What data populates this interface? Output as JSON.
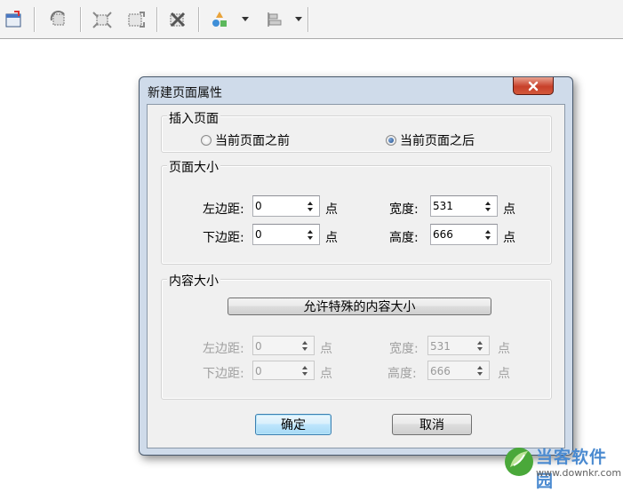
{
  "toolbar": {
    "icons": [
      "page-icon",
      "rotate-icon",
      "fit-page-icon",
      "fit-content-icon",
      "delete-icon",
      "shapes-icon",
      "align-icon"
    ]
  },
  "dialog": {
    "title": "新建页面属性",
    "insert_group": {
      "label": "插入页面",
      "option_before": "当前页面之前",
      "option_after": "当前页面之后",
      "selected": "option_after"
    },
    "page_size_group": {
      "label": "页面大小",
      "left_margin_label": "左边距:",
      "left_margin_value": "0",
      "bottom_margin_label": "下边距:",
      "bottom_margin_value": "0",
      "width_label": "宽度:",
      "width_value": "531",
      "height_label": "高度:",
      "height_value": "666",
      "unit": "点"
    },
    "content_size_group": {
      "label": "内容大小",
      "allow_button": "允许特殊的内容大小",
      "left_margin_label": "左边距:",
      "left_margin_value": "0",
      "bottom_margin_label": "下边距:",
      "bottom_margin_value": "0",
      "width_label": "宽度:",
      "width_value": "531",
      "height_label": "高度:",
      "height_value": "666",
      "unit": "点"
    },
    "ok_button": "确定",
    "cancel_button": "取消"
  },
  "watermark": {
    "name": "当客软件园",
    "url": "www.downkr.com"
  },
  "colors": {
    "dialog_frame": "#cfdbea",
    "close_button": "#c8402a",
    "default_button_border": "#3c7fb1",
    "watermark": "#4a8ad0"
  }
}
